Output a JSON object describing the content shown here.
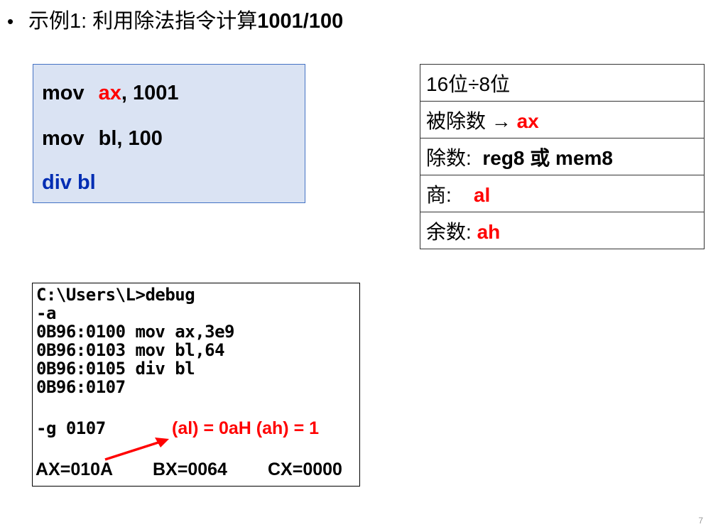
{
  "title": {
    "bullet": "•",
    "prefix": "示例1: 利用除法指令计算",
    "bold": "1001/100"
  },
  "code": {
    "line1_op": "mov",
    "line1_reg": "ax",
    "line1_rest": ", 1001",
    "line2_op": "mov",
    "line2_rest": "bl, 100",
    "line3": "div bl"
  },
  "table": {
    "row1": "16位÷8位",
    "row2_label": "被除数 → ",
    "row2_value": "ax",
    "row3_label": "除数: ",
    "row3_value": "reg8 或 mem8",
    "row4_label": "商: ",
    "row4_value": "al",
    "row5_label": "余数: ",
    "row5_value": "ah"
  },
  "console": {
    "lines": [
      "C:\\Users\\L>debug",
      "-a",
      "0B96:0100 mov ax,3e9",
      "0B96:0103 mov bl,64",
      "0B96:0105 div bl",
      "0B96:0107",
      "-g 0107"
    ],
    "annotation": "(al) = 0aH  (ah) = 1",
    "registers": [
      "AX=010A",
      "BX=0064",
      "CX=0000"
    ]
  },
  "page_number": "7",
  "colors": {
    "highlight": "#ff0000",
    "code_blue": "#002db3",
    "code_bg": "#dae3f3",
    "code_border": "#4472c4"
  }
}
